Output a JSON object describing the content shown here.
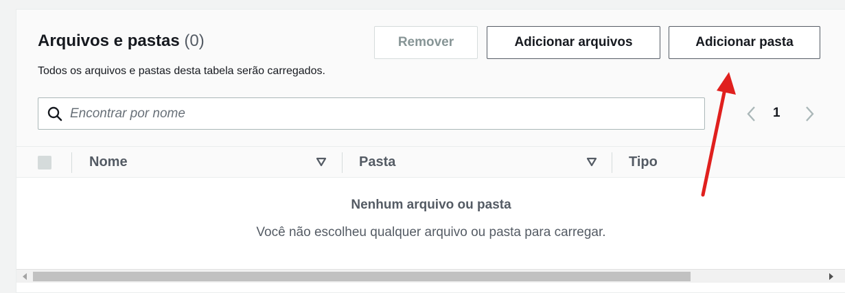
{
  "header": {
    "title": "Arquivos e pastas",
    "count": "(0)",
    "subtitle": "Todos os arquivos e pastas desta tabela serão carregados."
  },
  "buttons": {
    "remove": "Remover",
    "add_files": "Adicionar arquivos",
    "add_folder": "Adicionar pasta"
  },
  "search": {
    "placeholder": "Encontrar por nome",
    "value": ""
  },
  "pagination": {
    "current_page": "1"
  },
  "table": {
    "columns": [
      "Nome",
      "Pasta",
      "Tipo"
    ]
  },
  "empty_state": {
    "title": "Nenhum arquivo ou pasta",
    "description": "Você não escolheu qualquer arquivo ou pasta para carregar."
  },
  "colors": {
    "annotation_arrow": "#e0201e",
    "button_border": "#545b64",
    "disabled_text": "#879596"
  }
}
